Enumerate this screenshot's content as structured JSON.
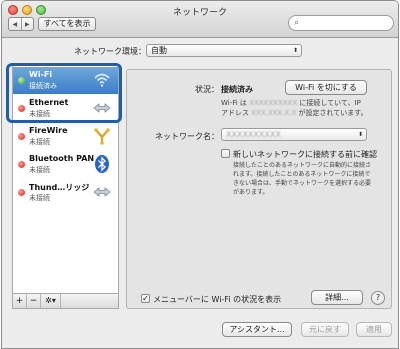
{
  "window": {
    "title": "ネットワーク"
  },
  "toolbar": {
    "back": "◀",
    "forward": "▶",
    "show_all": "すべてを表示",
    "search_placeholder": ""
  },
  "location": {
    "label": "ネットワーク環境：",
    "value": "自動"
  },
  "services": [
    {
      "name": "Wi-Fi",
      "status": "接続済み",
      "state": "connected",
      "icon": "wifi-icon"
    },
    {
      "name": "Ethernet",
      "status": "未接続",
      "state": "disconnected",
      "icon": "ethernet-arrows-icon"
    },
    {
      "name": "FireWire",
      "status": "未接続",
      "state": "disconnected",
      "icon": "firewire-icon"
    },
    {
      "name": "Bluetooth PAN",
      "status": "未接続",
      "state": "disconnected",
      "icon": "bluetooth-icon"
    },
    {
      "name": "Thund…リッジ",
      "status": "未接続",
      "state": "disconnected",
      "icon": "thunderbolt-bridge-arrows-icon"
    }
  ],
  "sidebar_footer": {
    "add": "+",
    "remove": "−",
    "gear": "✲▾"
  },
  "detail": {
    "status_label": "状況：",
    "status_value": "接続済み",
    "toggle_button": "Wi-Fi を切にする",
    "status_desc_pre": "Wi-Fi は",
    "status_desc_net": "XXXXXXXXXX",
    "status_desc_mid": "に接続していて、IP",
    "status_desc_addr_label": "アドレス",
    "status_desc_addr": "XXX.XXX.X.X",
    "status_desc_post": "が設定されています。",
    "network_name_label": "ネットワーク名：",
    "network_name_value": "XXXXXXXXXX",
    "ask_to_join_label": "新しいネットワークに接続する前に確認",
    "ask_to_join_help": "接続したことのあるネットワークに自動的に接続されます。接続したことのあるネットワークに接続できない場合は、手動でネットワークを選択する必要があります。",
    "show_menubar_label": "メニューバーに Wi-Fi の状況を表示",
    "advanced_button": "詳細...",
    "help_button": "?"
  },
  "bottom": {
    "assist": "アシスタント...",
    "revert": "元に戻す",
    "apply": "適用"
  },
  "colors": {
    "selection": "#3b7dc4",
    "highlight_border": "#1f5fa8",
    "connected": "#3aa52b",
    "disconnected": "#d2261c"
  }
}
